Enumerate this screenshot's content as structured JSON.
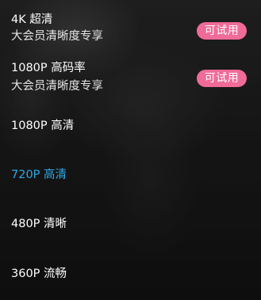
{
  "quality_menu": {
    "options": [
      {
        "label": "4K 超清",
        "sublabel": "大会员清晰度专享",
        "badge": "可试用",
        "selected": false
      },
      {
        "label": "1080P 高码率",
        "sublabel": "大会员清晰度专享",
        "badge": "可试用",
        "selected": false
      },
      {
        "label": "1080P 高清",
        "selected": false
      },
      {
        "label": "720P 高清",
        "selected": true
      },
      {
        "label": "480P 清晰",
        "selected": false
      },
      {
        "label": "360P 流畅",
        "selected": false
      }
    ]
  },
  "colors": {
    "selected_text": "#2ea8e6",
    "badge_background": "#f06b97",
    "text": "#ffffff"
  }
}
